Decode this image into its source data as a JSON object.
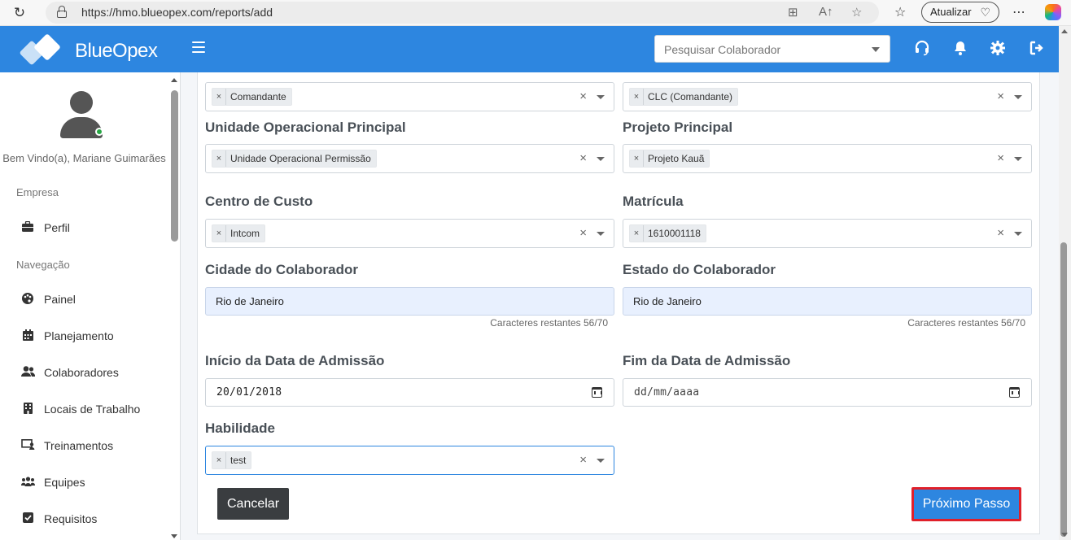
{
  "browser": {
    "url": "https://hmo.blueopex.com/reports/add",
    "update_label": "Atualizar"
  },
  "header": {
    "brand": "BlueOpex",
    "search_placeholder": "Pesquisar Colaborador"
  },
  "sidebar": {
    "welcome": "Bem Vindo(a), Mariane Guimarães",
    "section_company": "Empresa",
    "section_nav": "Navegação",
    "items": [
      {
        "label": "Perfil",
        "icon": "briefcase-icon"
      },
      {
        "label": "Painel",
        "icon": "palette-icon"
      },
      {
        "label": "Planejamento",
        "icon": "calendar-icon"
      },
      {
        "label": "Colaboradores",
        "icon": "users-icon"
      },
      {
        "label": "Locais de Trabalho",
        "icon": "building-icon"
      },
      {
        "label": "Treinamentos",
        "icon": "chalkboard-icon"
      },
      {
        "label": "Equipes",
        "icon": "team-icon"
      },
      {
        "label": "Requisitos",
        "icon": "checkbox-icon"
      }
    ]
  },
  "form": {
    "cargo_chip": "Comandante",
    "cargo2_chip": "CLC (Comandante)",
    "unidade_label": "Unidade Operacional Principal",
    "unidade_chip": "Unidade Operacional Permissão",
    "projeto_label": "Projeto Principal",
    "projeto_chip": "Projeto Kauã",
    "centro_label": "Centro de Custo",
    "centro_chip": "Intcom",
    "matricula_label": "Matrícula",
    "matricula_chip": "1610001118",
    "cidade_label": "Cidade do Colaborador",
    "cidade_value": "Rio de Janeiro",
    "cidade_counter": "Caracteres restantes 56/70",
    "estado_label": "Estado do Colaborador",
    "estado_value": "Rio de Janeiro",
    "estado_counter": "Caracteres restantes 56/70",
    "inicio_label": "Início da Data de Admissão",
    "inicio_value": "20/01/2018",
    "fim_label": "Fim da Data de Admissão",
    "fim_value": "dd/mm/aaaa",
    "habilidade_label": "Habilidade",
    "habilidade_chip": "test",
    "chip_remove": "×",
    "clear_glyph": "×",
    "cancel_label": "Cancelar",
    "next_label": "Próximo Passo"
  }
}
